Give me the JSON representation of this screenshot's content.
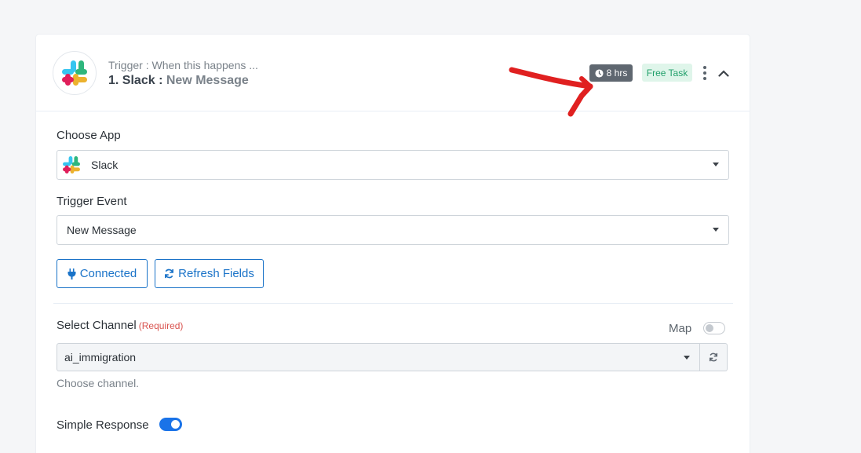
{
  "header": {
    "trigger_label": "Trigger : When this happens ...",
    "step_number": "1.",
    "app_name": "Slack",
    "separator": ":",
    "event_name": "New Message",
    "time_badge": "8 hrs",
    "task_badge": "Free Task"
  },
  "choose_app": {
    "label": "Choose App",
    "value": "Slack",
    "icon": "slack-logo"
  },
  "trigger_event": {
    "label": "Trigger Event",
    "value": "New Message"
  },
  "buttons": {
    "connected": "Connected",
    "refresh_fields": "Refresh Fields"
  },
  "select_channel": {
    "label": "Select Channel",
    "required": "(Required)",
    "map_label": "Map",
    "map_enabled": false,
    "value": "ai_immigration",
    "help": "Choose channel."
  },
  "simple_response": {
    "label": "Simple Response",
    "enabled": true
  },
  "colors": {
    "accent": "#1a73c8",
    "toggle_on": "#1a73e8",
    "annotation_arrow": "#e02020",
    "free_task_bg": "#dff5ea",
    "free_task_text": "#22a06b",
    "time_badge_bg": "#5f6770"
  }
}
